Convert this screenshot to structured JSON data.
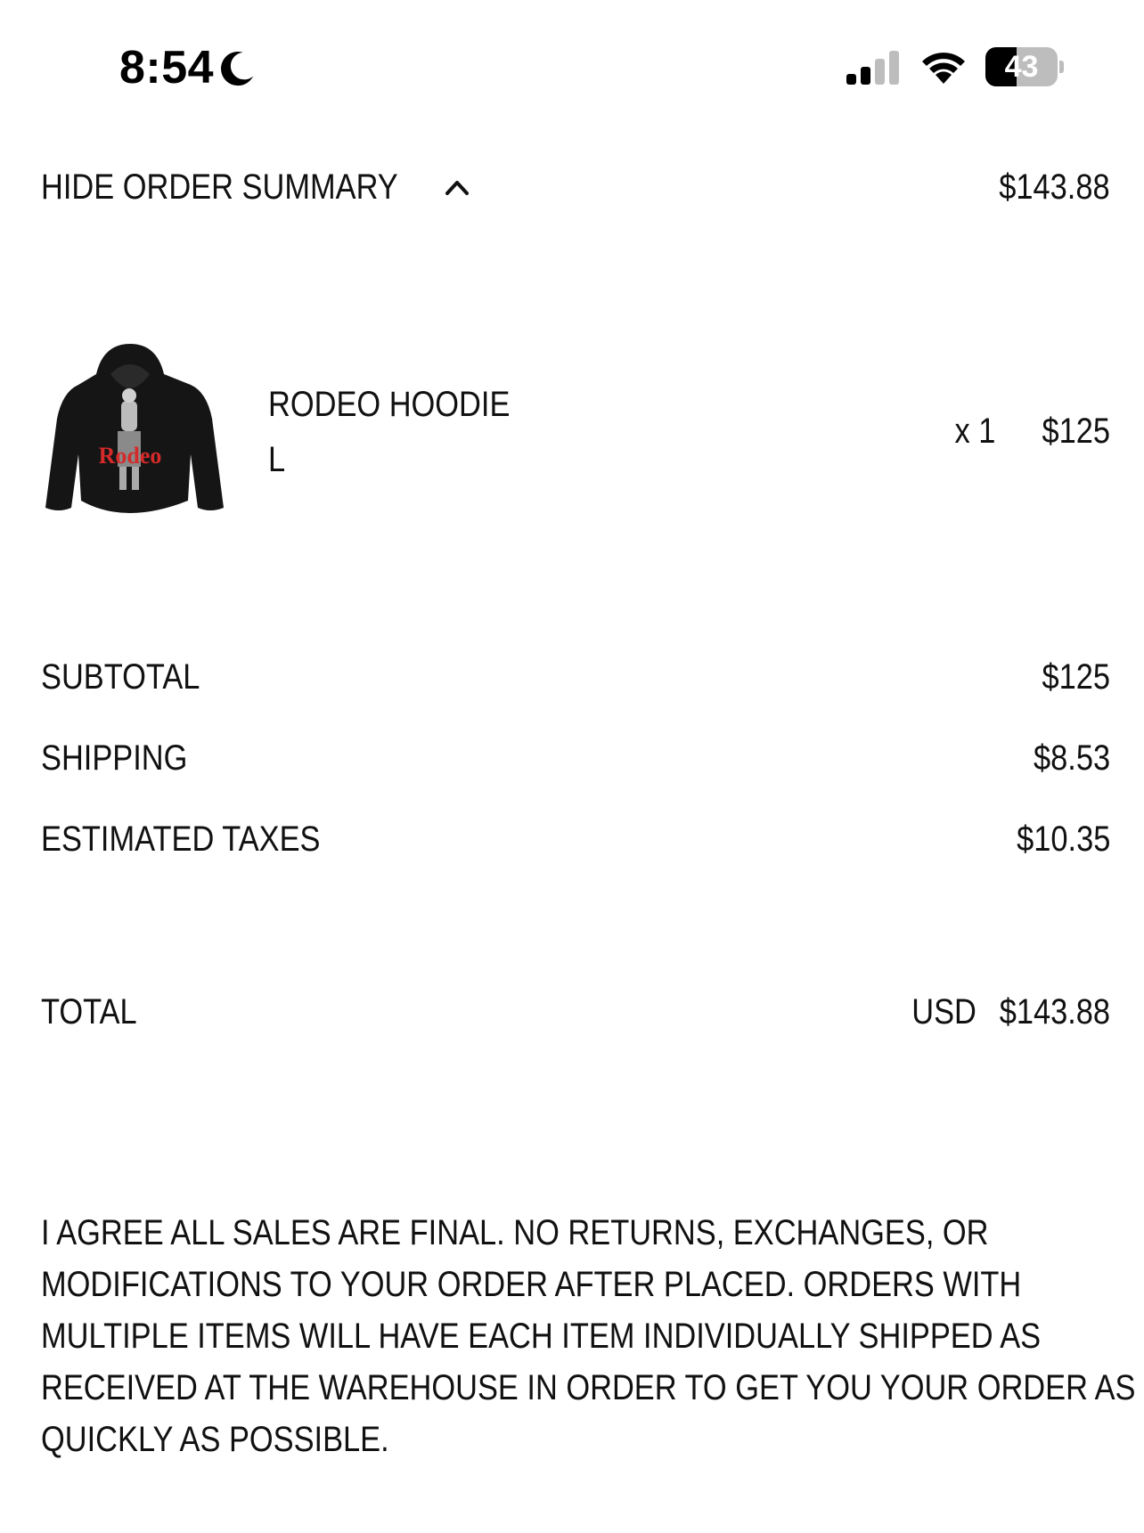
{
  "status_bar": {
    "time": "8:54",
    "battery_level": "43",
    "battery_fraction": 0.43,
    "moon_icon": "moon-icon",
    "signal_icon": "cellular-signal-icon",
    "wifi_icon": "wifi-icon"
  },
  "summary": {
    "toggle_label": "HIDE ORDER SUMMARY",
    "toggle_icon": "chevron-up-icon",
    "amount": "$143.88"
  },
  "product": {
    "name": "RODEO HOODIE",
    "variant": "L",
    "quantity": "x 1",
    "price": "$125",
    "graphic_text": "Rodeo"
  },
  "totals": {
    "subtotal_label": "SUBTOTAL",
    "subtotal_value": "$125",
    "shipping_label": "SHIPPING",
    "shipping_value": "$8.53",
    "taxes_label": "ESTIMATED TAXES",
    "taxes_value": "$10.35",
    "total_label": "TOTAL",
    "total_currency": "USD",
    "total_value": "$143.88"
  },
  "disclaimer": {
    "lines": [
      "I AGREE ALL SALES ARE FINAL. NO RETURNS, EXCHANGES, OR",
      "MODIFICATIONS TO YOUR ORDER AFTER PLACED. ORDERS WITH",
      "MULTIPLE ITEMS WILL HAVE EACH ITEM INDIVIDUALLY SHIPPED AS",
      "RECEIVED AT THE WAREHOUSE IN ORDER TO GET YOU YOUR ORDER AS",
      "QUICKLY AS POSSIBLE."
    ]
  },
  "colors": {
    "text": "#111111",
    "background": "#ffffff",
    "graphic_red": "#d42a2a"
  }
}
